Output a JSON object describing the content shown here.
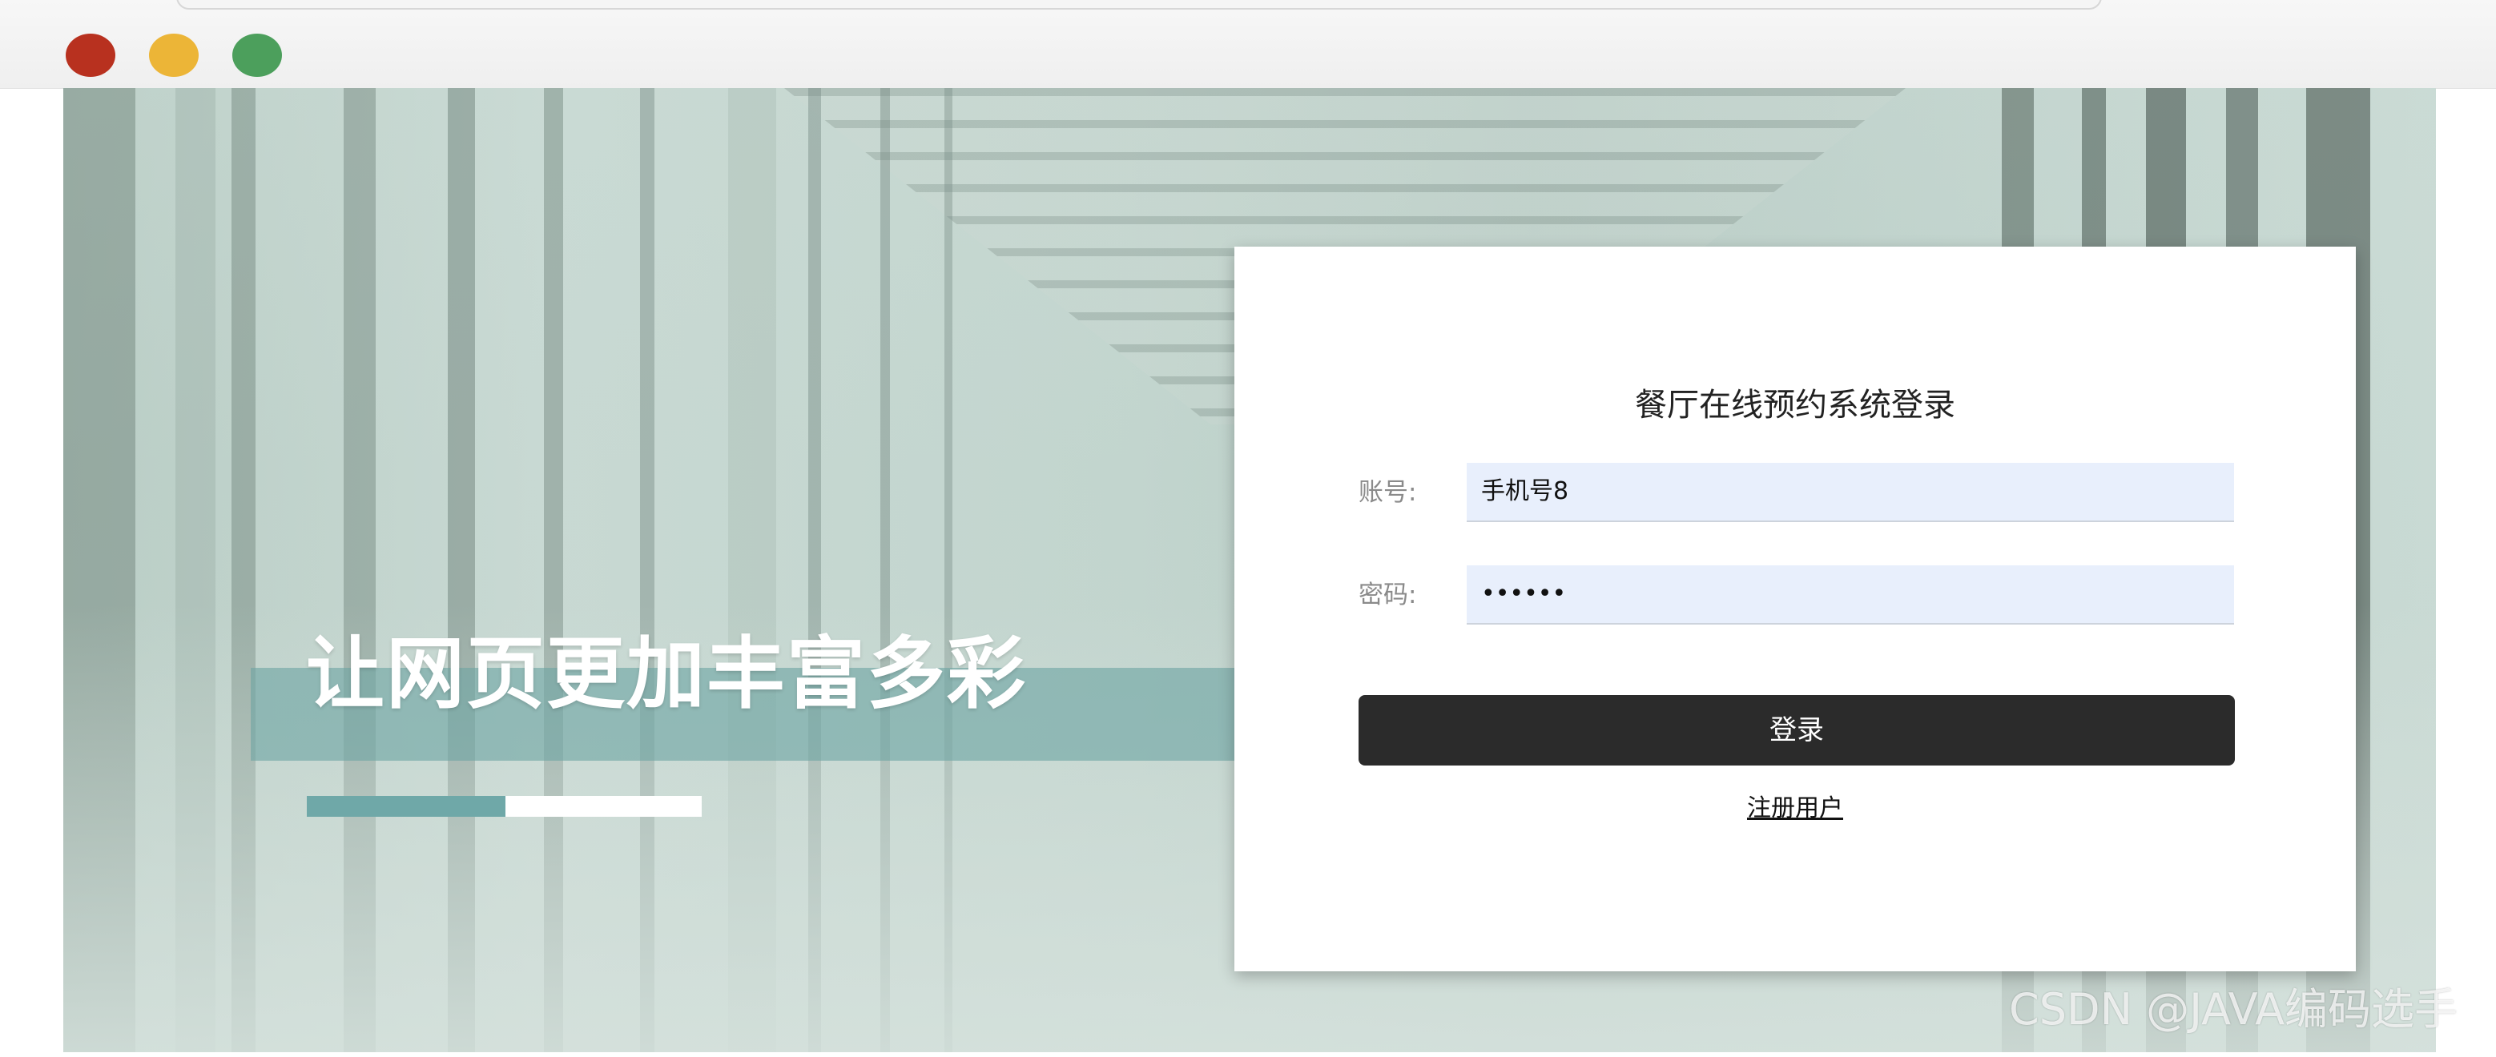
{
  "window": {
    "controls": [
      "close",
      "minimize",
      "maximize"
    ],
    "colors": {
      "close": "#b8311f",
      "minimize": "#ecb537",
      "maximize": "#4c9f5c"
    }
  },
  "hero": {
    "headline": "让网页更加丰富多彩",
    "band_color": "#6fa8a8"
  },
  "login": {
    "title": "餐厅在线预约系统登录",
    "account_label": "账号:",
    "account_value": "手机号8",
    "password_label": "密码:",
    "password_value": "••••••",
    "submit_label": "登录",
    "register_label": "注册用户",
    "button_color": "#2b2b2b",
    "input_bg": "#e8effc"
  },
  "watermark": "CSDN @JAVA编码选手"
}
